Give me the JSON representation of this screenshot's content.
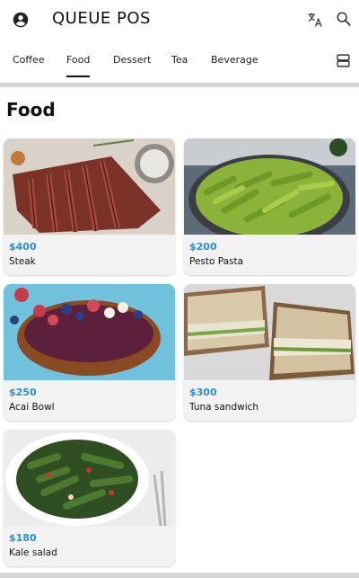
{
  "app": {
    "title": "QUEUE POS"
  },
  "header_icons": [
    "account-circle-icon",
    "translate-icon",
    "search-icon"
  ],
  "tabs": [
    {
      "label": "Coffee",
      "active": false
    },
    {
      "label": "Food",
      "active": true
    },
    {
      "label": "Dessert",
      "active": false
    },
    {
      "label": "Tea",
      "active": false
    },
    {
      "label": "Beverage",
      "active": false
    }
  ],
  "section": {
    "title": "Food"
  },
  "products": [
    {
      "name": "Steak",
      "price": "$400"
    },
    {
      "name": "Pesto Pasta",
      "price": "$200"
    },
    {
      "name": "Acai Bowl",
      "price": "$250"
    },
    {
      "name": "Tuna sandwich",
      "price": "$300"
    },
    {
      "name": "Kale salad",
      "price": "$180"
    }
  ],
  "colors": {
    "accent_price": "#2a8ed0",
    "divider": "#d6d6d6",
    "card_bg": "#f2f2f2"
  }
}
